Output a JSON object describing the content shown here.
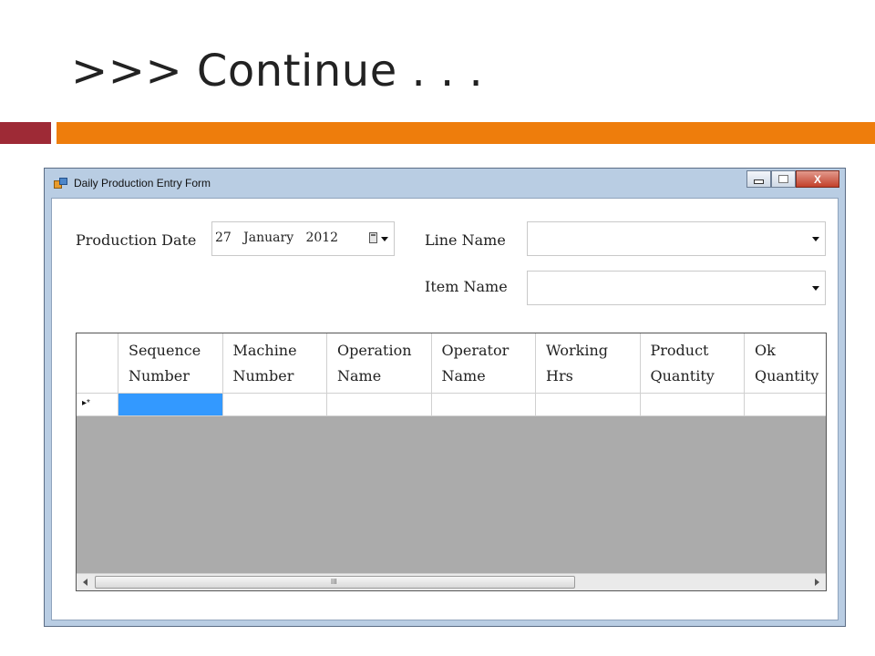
{
  "slide": {
    "title": ">>> Continue . . ."
  },
  "window": {
    "title": "Daily Production Entry Form",
    "buttons": {
      "close_label": "X"
    }
  },
  "form": {
    "production_date_label": "Production Date",
    "production_date_value": "27   January   2012",
    "line_name_label": "Line Name",
    "line_name_value": "",
    "item_name_label": "Item Name",
    "item_name_value": ""
  },
  "grid": {
    "columns": [
      "Sequence\nNumber",
      "Machine\nNumber",
      "Operation\nName",
      "Operator\nName",
      "Working\nHrs",
      "Product\nQuantity",
      "Ok\nQuantity"
    ],
    "new_row_marker": "▸*",
    "scrollbar_grip": "III"
  }
}
